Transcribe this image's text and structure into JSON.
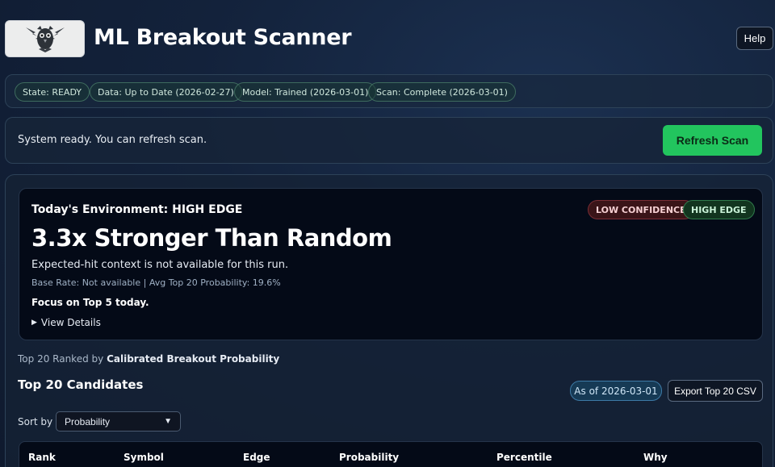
{
  "header": {
    "title": "ML Breakout Scanner",
    "help_label": "Help",
    "logo_icon": "owl-emblem-icon"
  },
  "status": {
    "pills": [
      "State: READY",
      "Data: Up to Date (2026-02-27)",
      "Model: Trained (2026-03-01)",
      "Scan: Complete (2026-03-01)"
    ]
  },
  "message": {
    "text": "System ready. You can refresh scan.",
    "refresh_label": "Refresh Scan"
  },
  "environment": {
    "title": "Today's Environment: HIGH EDGE",
    "badges": [
      "LOW CONFIDENCE",
      "HIGH EDGE"
    ],
    "headline": "3.3x Stronger Than Random",
    "context": "Expected-hit context is not available for this run.",
    "base_rate": "Base Rate: Not available | Avg Top 20 Probability: 19.6%",
    "focus": "Focus on Top 5 today.",
    "details_label": "View Details"
  },
  "ranking": {
    "prefix": "Top 20 Ranked by ",
    "metric": "Calibrated Breakout Probability"
  },
  "candidates": {
    "title": "Top 20 Candidates",
    "as_of": "As of 2026-03-01",
    "export_label": "Export Top 20 CSV",
    "sort_label": "Sort by",
    "sort_value": "Probability",
    "columns": [
      "Rank",
      "Symbol",
      "Edge",
      "Probability",
      "Percentile",
      "Why"
    ]
  },
  "colors": {
    "accent_green": "#22c55e",
    "background": "#13223b",
    "card": "#040a17"
  }
}
